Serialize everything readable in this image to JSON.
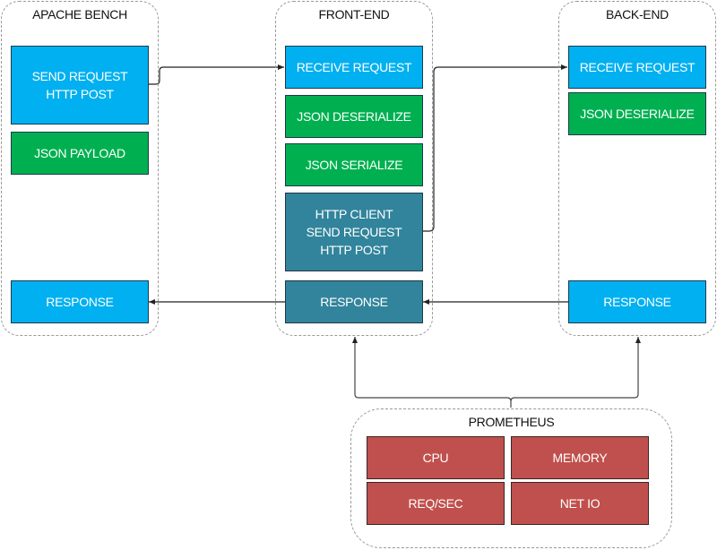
{
  "colors": {
    "request": "#00b0f0",
    "json": "#00b050",
    "client": "#31849b",
    "metric": "#c0504d",
    "group_border": "#9a9a9a",
    "connector": "#222222"
  },
  "groups": {
    "apache_bench": {
      "title": "APACHE BENCH",
      "send_request": "SEND REQUEST\nHTTP POST",
      "json_payload": "JSON PAYLOAD",
      "response": "RESPONSE"
    },
    "front_end": {
      "title": "FRONT-END",
      "receive_request": "RECEIVE REQUEST",
      "json_deserialize": "JSON DESERIALIZE",
      "json_serialize": "JSON SERIALIZE",
      "http_client": "HTTP CLIENT\nSEND REQUEST\nHTTP POST",
      "response": "RESPONSE"
    },
    "back_end": {
      "title": "BACK-END",
      "receive_request": "RECEIVE REQUEST",
      "json_deserialize": "JSON DESERIALIZE",
      "response": "RESPONSE"
    },
    "prometheus": {
      "title": "PROMETHEUS",
      "metrics": [
        "CPU",
        "MEMORY",
        "REQ/SEC",
        "NET IO"
      ]
    }
  },
  "connections": [
    {
      "from": "apache-bench-send-request",
      "to": "front-end-receive-request"
    },
    {
      "from": "front-end-http-client",
      "to": "back-end-receive-request"
    },
    {
      "from": "back-end-response",
      "to": "front-end-response"
    },
    {
      "from": "front-end-response",
      "to": "apache-bench-response"
    },
    {
      "from": "prometheus",
      "to": "front-end"
    },
    {
      "from": "prometheus",
      "to": "back-end"
    }
  ]
}
